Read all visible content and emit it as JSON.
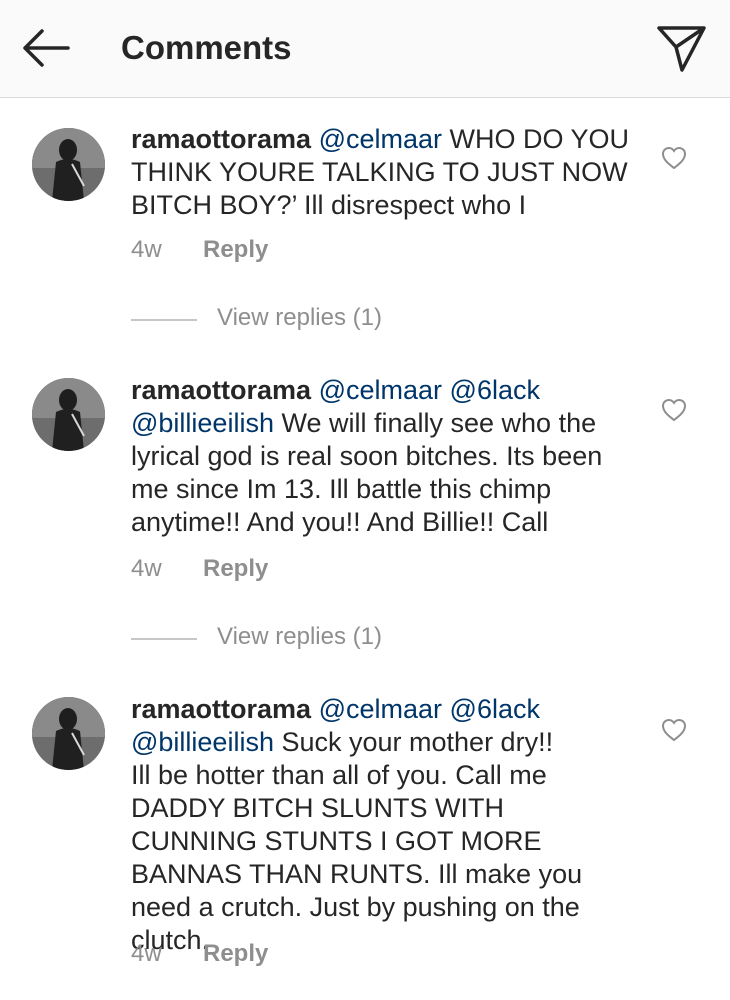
{
  "header": {
    "title": "Comments",
    "back_icon": "arrow-left-icon",
    "share_icon": "paper-plane-icon"
  },
  "comments": [
    {
      "username": "ramaottorama",
      "segments": [
        {
          "type": "mention",
          "text": "@celmaar"
        },
        {
          "type": "text",
          "text": " WHO DO YOU THINK YOURE TALKING TO JUST NOW BITCH BOY?’ Ill disrespect who I"
        }
      ],
      "time": "4w",
      "reply_label": "Reply",
      "view_replies": "View replies (1)"
    },
    {
      "username": "ramaottorama",
      "segments": [
        {
          "type": "mention",
          "text": "@celmaar"
        },
        {
          "type": "text",
          "text": " "
        },
        {
          "type": "mention",
          "text": "@6lack"
        },
        {
          "type": "text",
          "text": " "
        },
        {
          "type": "mention",
          "text": "@billieeilish"
        },
        {
          "type": "text",
          "text": " We will finally see who the lyrical god is real soon bitches. Its been me since Im 13. Ill battle this chimp anytime!! And you!! And Billie!! Call"
        }
      ],
      "time": "4w",
      "reply_label": "Reply",
      "view_replies": "View replies (1)"
    },
    {
      "username": "ramaottorama",
      "segments": [
        {
          "type": "mention",
          "text": "@celmaar"
        },
        {
          "type": "text",
          "text": " "
        },
        {
          "type": "mention",
          "text": "@6lack"
        },
        {
          "type": "text",
          "text": " "
        },
        {
          "type": "mention",
          "text": "@billieeilish"
        },
        {
          "type": "text",
          "text": " Suck your mother dry!!"
        },
        {
          "type": "break"
        },
        {
          "type": "text",
          "text": "Ill be hotter than all of you. Call me DADDY BITCH SLUNTS WITH CUNNING STUNTS I GOT MORE BANNAS THAN RUNTS. Ill make you need a crutch. Just by pushing on the clutch."
        }
      ],
      "time": "4w",
      "reply_label": "Reply"
    }
  ],
  "colors": {
    "text": "#262626",
    "mention": "#003569",
    "secondary": "#8e8e8e",
    "header_bg": "#fafafa"
  }
}
